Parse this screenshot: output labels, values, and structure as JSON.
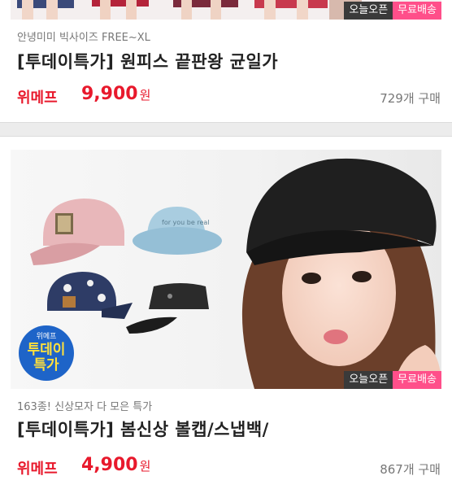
{
  "product1": {
    "badge_open": "오늘오픈",
    "badge_free": "무료배송",
    "subtitle": "안녕미미 빅사이즈 FREE~XL",
    "title": "[투데이특가] 원피스 끝판왕 균일가",
    "store": "위메프",
    "price": "9,900",
    "currency": "원",
    "sold": "729개 구매"
  },
  "product2": {
    "stamp_top": "위메프",
    "stamp_main": "투데이",
    "stamp_bottom": "특가",
    "hat_text": "for you be real",
    "badge_open": "오늘오픈",
    "badge_free": "무료배송",
    "subtitle": "163종! 신상모자 다 모은 특가",
    "title": "[투데이특가] 봄신상 볼캡/스냅백/",
    "store": "위메프",
    "price": "4,900",
    "currency": "원",
    "sold": "867개 구매"
  },
  "colors": {
    "accent_red": "#e8192c",
    "badge_pink": "#ff4f8a",
    "badge_dark": "#3a3a3a",
    "stamp_blue": "#1e64c8",
    "stamp_yellow": "#ffe03c"
  }
}
